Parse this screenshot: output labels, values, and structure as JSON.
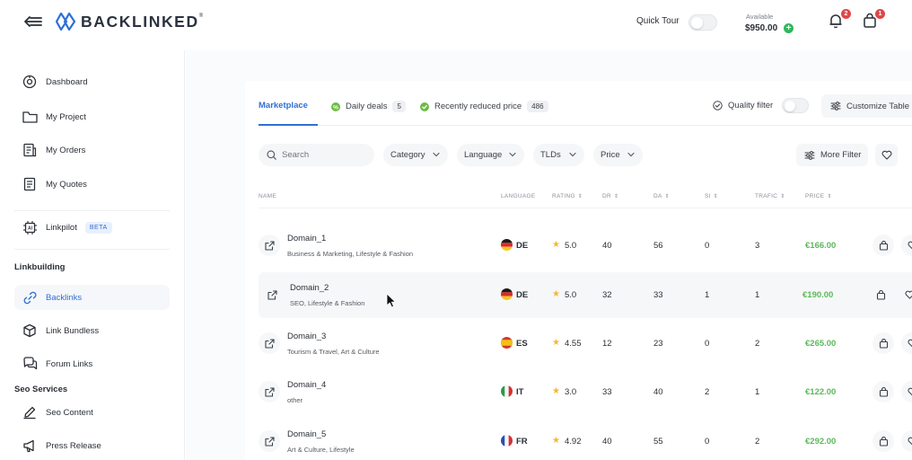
{
  "brand": {
    "name": "BACKLINKED",
    "reg": "®"
  },
  "header": {
    "quick_tour": "Quick Tour",
    "available_label": "Available",
    "available_amount": "$950.00",
    "notifications_count": "2",
    "cart_count": "1"
  },
  "sidebar": {
    "items": [
      {
        "label": "Dashboard",
        "icon": "dashboard-icon"
      },
      {
        "label": "My Project",
        "icon": "folder-icon"
      },
      {
        "label": "My Orders",
        "icon": "orders-icon"
      },
      {
        "label": "My Quotes",
        "icon": "quotes-icon"
      },
      {
        "label": "Linkpilot",
        "icon": "chip-icon",
        "badge": "BETA"
      }
    ],
    "section_linkbuilding": "Linkbuilding",
    "linkbuilding_items": [
      {
        "label": "Backlinks",
        "icon": "link-icon",
        "active": true
      },
      {
        "label": "Link Bundless",
        "icon": "cube-icon"
      },
      {
        "label": "Forum Links",
        "icon": "chat-icon"
      }
    ],
    "section_seo": "Seo Services",
    "seo_items": [
      {
        "label": "Seo Content",
        "icon": "pen-icon"
      },
      {
        "label": "Press Release",
        "icon": "megaphone-icon"
      }
    ]
  },
  "tabs": [
    {
      "label": "Marketplace",
      "active": true
    },
    {
      "label": "Daily deals",
      "count": "5"
    },
    {
      "label": "Recently reduced price",
      "count": "486"
    }
  ],
  "toolbar": {
    "quality_filter": "Quality filter",
    "customize_table": "Customize Table"
  },
  "filters": {
    "search_placeholder": "Search",
    "category": "Category",
    "language": "Language",
    "tlds": "TLDs",
    "price": "Price",
    "more_filter": "More Filter"
  },
  "table": {
    "columns": [
      "NAME",
      "LANGUAGE",
      "RATING",
      "DR",
      "DA",
      "SI",
      "TRAFIC",
      "PRICE"
    ],
    "rows": [
      {
        "name": "Domain_1",
        "categories": "Business & Marketing, Lifestyle & Fashion",
        "flag": "de",
        "lang": "DE",
        "rating": "5.0",
        "dr": "40",
        "da": "56",
        "si": "0",
        "trafic": "3",
        "price": "€166.00"
      },
      {
        "name": "Domain_2",
        "categories": "SEO, Lifestyle & Fashion",
        "flag": "de",
        "lang": "DE",
        "rating": "5.0",
        "dr": "32",
        "da": "33",
        "si": "1",
        "trafic": "1",
        "price": "€190.00"
      },
      {
        "name": "Domain_3",
        "categories": "Tourism & Travel, Art & Culture",
        "flag": "es",
        "lang": "ES",
        "rating": "4.55",
        "dr": "12",
        "da": "23",
        "si": "0",
        "trafic": "2",
        "price": "€265.00"
      },
      {
        "name": "Domain_4",
        "categories": "other",
        "flag": "it",
        "lang": "IT",
        "rating": "3.0",
        "dr": "33",
        "da": "40",
        "si": "2",
        "trafic": "1",
        "price": "€122.00"
      },
      {
        "name": "Domain_5",
        "categories": "Art & Culture, Lifestyle",
        "flag": "fr",
        "lang": "FR",
        "rating": "4.92",
        "dr": "40",
        "da": "55",
        "si": "0",
        "trafic": "2",
        "price": "€292.00"
      }
    ]
  },
  "colors": {
    "accent": "#2f6fd6",
    "price_green": "#5cb85c",
    "badge_red": "#e04747",
    "star": "#f5b731"
  }
}
